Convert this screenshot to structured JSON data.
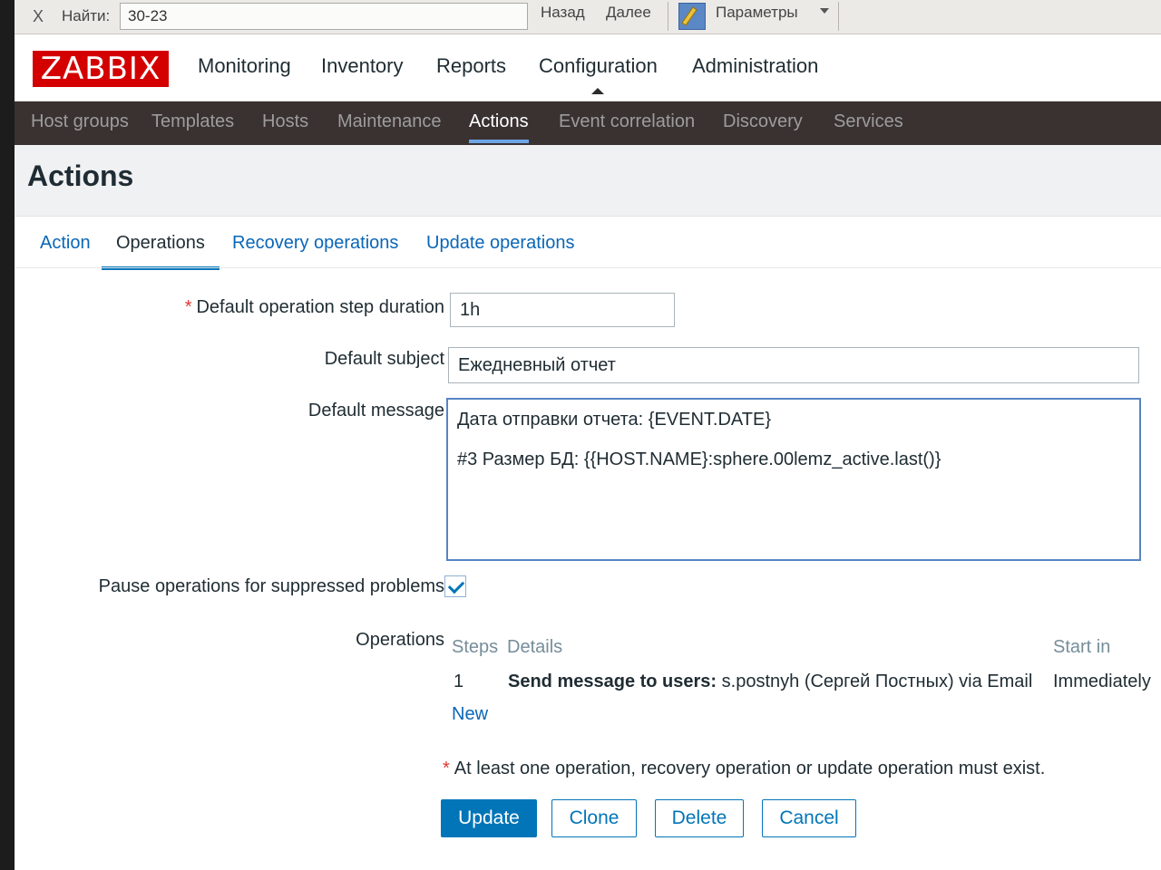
{
  "findbar": {
    "close": "X",
    "find_label": "Найти:",
    "find_value": "30-23",
    "back": "Назад",
    "forward": "Далее",
    "params": "Параметры"
  },
  "header": {
    "logo": "ZABBIX",
    "menu": [
      "Monitoring",
      "Inventory",
      "Reports",
      "Configuration",
      "Administration"
    ]
  },
  "submenu": [
    "Host groups",
    "Templates",
    "Hosts",
    "Maintenance",
    "Actions",
    "Event correlation",
    "Discovery",
    "Services"
  ],
  "page": {
    "title": "Actions"
  },
  "tabs": [
    "Action",
    "Operations",
    "Recovery operations",
    "Update operations"
  ],
  "form": {
    "step_duration_label": "Default operation step duration",
    "step_duration_value": "1h",
    "subject_label": "Default subject",
    "subject_value": "Ежедневный отчет",
    "message_label": "Default message",
    "message_value": "Дата отправки отчета: {EVENT.DATE}\n#3 Размер БД: {{HOST.NAME}:sphere.00lemz_active.last()}",
    "pause_label": "Pause operations for suppressed problems",
    "pause_checked": true,
    "operations_label": "Operations"
  },
  "operations": {
    "headers": {
      "steps": "Steps",
      "details": "Details",
      "start_in": "Start in"
    },
    "rows": [
      {
        "step": "1",
        "details_bold": "Send message to users:",
        "details_rest": "s.postnyh (Сергей Постных) via Email",
        "start_in": "Immediately"
      }
    ],
    "new_link": "New"
  },
  "note": "At least one operation, recovery operation or update operation must exist.",
  "buttons": {
    "update": "Update",
    "clone": "Clone",
    "delete": "Delete",
    "cancel": "Cancel"
  }
}
